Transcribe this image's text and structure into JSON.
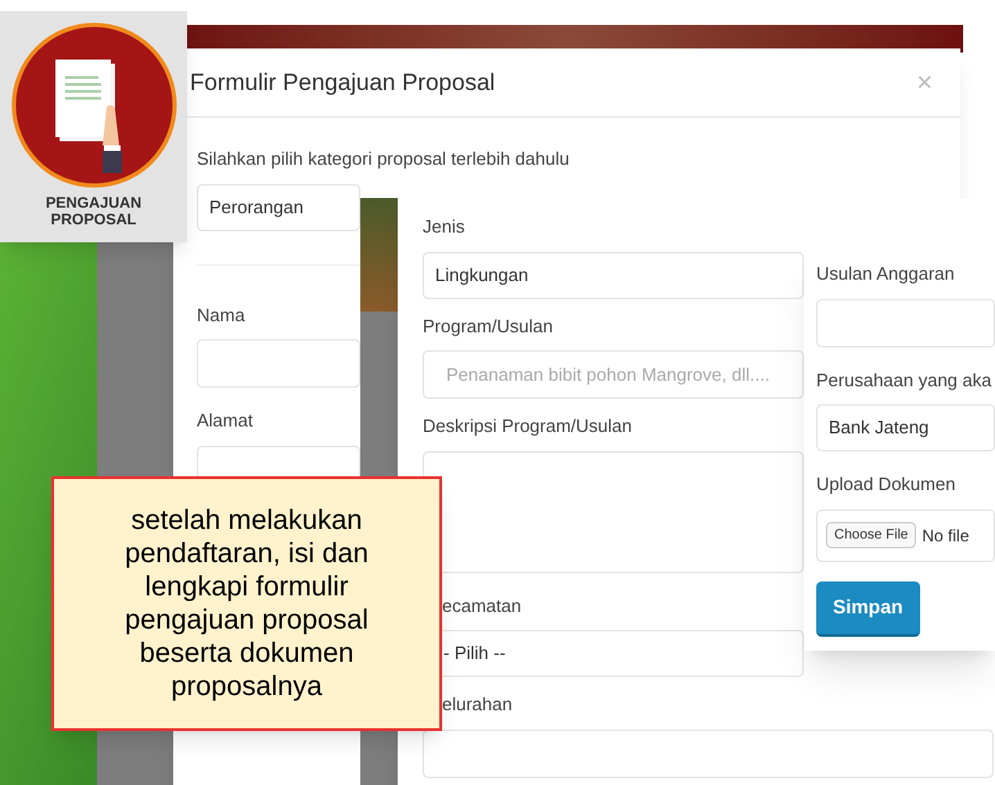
{
  "badge": {
    "label": "PENGAJUAN PROPOSAL"
  },
  "modal": {
    "title": "Formulir Pengajuan Proposal",
    "close": "×",
    "fields": [
      {
        "kind": "select",
        "label": "Silahkan pilih kategori proposal terlebih dahulu",
        "value": "Perorangan"
      },
      {
        "kind": "input",
        "label": "Nama"
      },
      {
        "kind": "input",
        "label": "Alamat"
      }
    ]
  },
  "form_2": {
    "fields": [
      {
        "kind": "select",
        "label": "Jenis",
        "value": "Lingkungan"
      },
      {
        "kind": "input",
        "label": "Program/Usulan",
        "placeholder": "Penanaman bibit pohon Mangrove, dll...."
      },
      {
        "kind": "textarea",
        "label": "Deskripsi Program/Usulan"
      },
      {
        "kind": "select",
        "label": "ecamatan",
        "value": "- Pilih --"
      },
      {
        "kind": "input",
        "label": "elurahan"
      }
    ]
  },
  "form_3": {
    "fields": [
      {
        "kind": "input",
        "label": "Usulan Anggaran"
      },
      {
        "kind": "select",
        "label": "Perusahaan yang aka",
        "value": "Bank Jateng"
      },
      {
        "kind": "file",
        "label": "Upload Dokumen",
        "button": "Choose File",
        "value": "No file"
      }
    ],
    "submit": "Simpan"
  },
  "callout": {
    "text": "setelah melakukan pendaftaran, isi dan lengkapi formulir pengajuan proposal beserta dokumen proposalnya"
  }
}
